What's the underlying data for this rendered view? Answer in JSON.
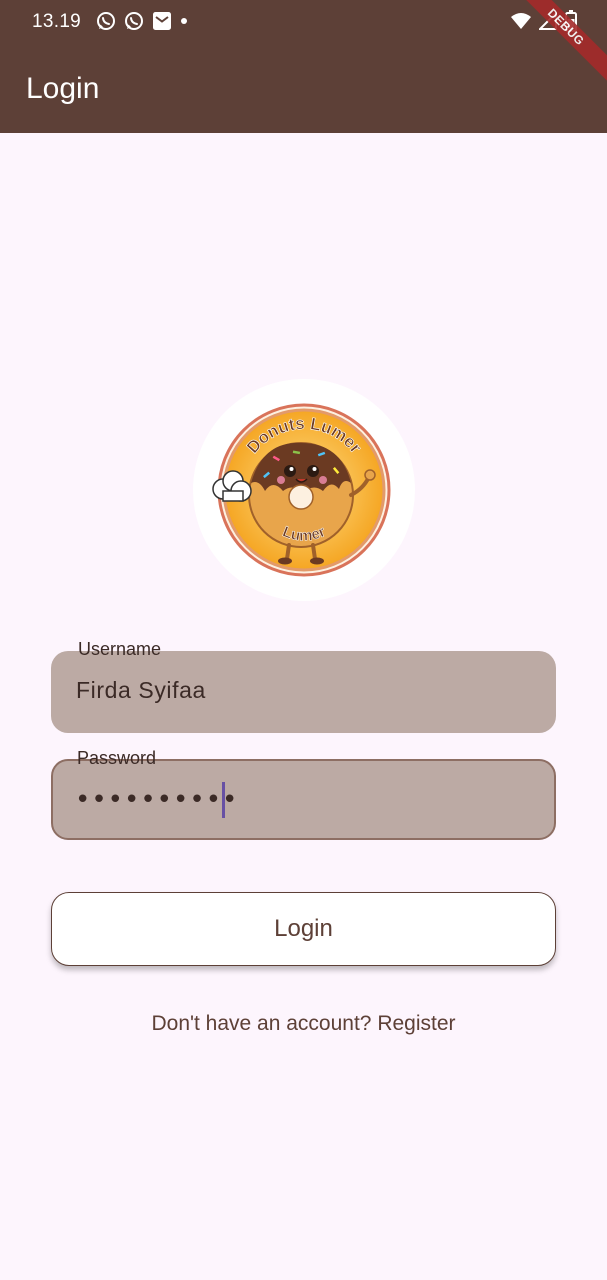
{
  "status_bar": {
    "time": "13.19",
    "left_icons": [
      "whatsapp-icon",
      "whatsapp-icon",
      "mail-icon",
      "dot-icon"
    ],
    "right_icons": [
      "wifi-icon",
      "signal-icon",
      "battery-icon"
    ]
  },
  "debug_banner": "DEBUG",
  "app_bar": {
    "title": "Login",
    "background": "#5d4037"
  },
  "logo": {
    "text_top": "Donuts Lumer",
    "text_bottom": "Lumer"
  },
  "form": {
    "username": {
      "label": "Username",
      "value": "Firda Syifaa"
    },
    "password": {
      "label": "Password",
      "mask": "••••••••••"
    },
    "login_button": "Login",
    "register_link": "Don't have an account? Register"
  },
  "colors": {
    "page_background": "#fdf5fd",
    "field_fill": "#bcaaa4",
    "accent_brown": "#5d4037",
    "caret": "#6750a4"
  }
}
